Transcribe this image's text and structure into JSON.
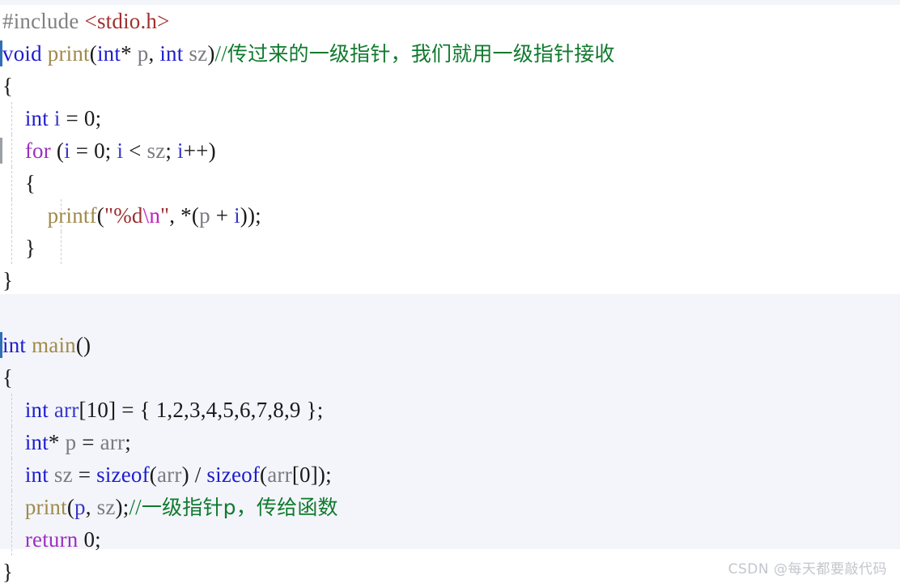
{
  "document": {
    "type": "c-source-code-snippet",
    "language": "C",
    "watermark": "CSDN @每天都要敲代码",
    "colors": {
      "background": "#ffffff",
      "block_tint": "#f4f5fa",
      "preprocessor": "#808080",
      "header_string": "#a03030",
      "keyword": "#1c1cd1",
      "control_keyword": "#9b30c0",
      "function_name": "#a08a4a",
      "variable": "#7a7a82",
      "comment": "#0f7a2e",
      "string": "#9b2f2f",
      "escape": "#c020c0",
      "change_bar": "#2f6fb5",
      "indent_guide": "#c9ccd4",
      "watermark": "#c3c6cc"
    }
  },
  "code": {
    "lines": [
      {
        "n": 1,
        "tokens": [
          {
            "t": "#include ",
            "c": "pp"
          },
          {
            "t": "<stdio.h>",
            "c": "hdr"
          }
        ]
      },
      {
        "n": 2,
        "tokens": [
          {
            "t": "void",
            "c": "kw"
          },
          {
            "t": " ",
            "c": "punct"
          },
          {
            "t": "print",
            "c": "fn"
          },
          {
            "t": "(",
            "c": "punct"
          },
          {
            "t": "int",
            "c": "kw"
          },
          {
            "t": "* ",
            "c": "punct"
          },
          {
            "t": "p",
            "c": "var"
          },
          {
            "t": ", ",
            "c": "punct"
          },
          {
            "t": "int",
            "c": "kw"
          },
          {
            "t": " ",
            "c": "punct"
          },
          {
            "t": "sz",
            "c": "var"
          },
          {
            "t": ")",
            "c": "punct"
          },
          {
            "t": "//",
            "c": "cmt"
          },
          {
            "t": "传过来的一级指针，我们就用一级指针接收",
            "c": "cmt-cn"
          }
        ]
      },
      {
        "n": 3,
        "tokens": [
          {
            "t": "{",
            "c": "punct"
          }
        ]
      },
      {
        "n": 4,
        "tokens": [
          {
            "t": "    ",
            "c": "punct"
          },
          {
            "t": "int",
            "c": "kw"
          },
          {
            "t": " ",
            "c": "punct"
          },
          {
            "t": "i",
            "c": "varb"
          },
          {
            "t": " = ",
            "c": "punct"
          },
          {
            "t": "0",
            "c": "num"
          },
          {
            "t": ";",
            "c": "punct"
          }
        ]
      },
      {
        "n": 5,
        "tokens": [
          {
            "t": "    ",
            "c": "punct"
          },
          {
            "t": "for",
            "c": "kw2"
          },
          {
            "t": " (",
            "c": "punct"
          },
          {
            "t": "i",
            "c": "varb"
          },
          {
            "t": " = ",
            "c": "punct"
          },
          {
            "t": "0",
            "c": "num"
          },
          {
            "t": "; ",
            "c": "punct"
          },
          {
            "t": "i",
            "c": "varb"
          },
          {
            "t": " < ",
            "c": "punct"
          },
          {
            "t": "sz",
            "c": "var"
          },
          {
            "t": "; ",
            "c": "punct"
          },
          {
            "t": "i",
            "c": "varb"
          },
          {
            "t": "++)",
            "c": "punct"
          }
        ]
      },
      {
        "n": 6,
        "tokens": [
          {
            "t": "    ",
            "c": "punct"
          },
          {
            "t": "{",
            "c": "punct"
          }
        ]
      },
      {
        "n": 7,
        "tokens": [
          {
            "t": "        ",
            "c": "punct"
          },
          {
            "t": "printf",
            "c": "fn"
          },
          {
            "t": "(",
            "c": "punct"
          },
          {
            "t": "\"%d",
            "c": "str"
          },
          {
            "t": "\\n",
            "c": "esc"
          },
          {
            "t": "\"",
            "c": "str"
          },
          {
            "t": ", *(",
            "c": "punct"
          },
          {
            "t": "p",
            "c": "var"
          },
          {
            "t": " + ",
            "c": "punct"
          },
          {
            "t": "i",
            "c": "varb"
          },
          {
            "t": "));",
            "c": "punct"
          }
        ]
      },
      {
        "n": 8,
        "tokens": [
          {
            "t": "    ",
            "c": "punct"
          },
          {
            "t": "}",
            "c": "punct"
          }
        ]
      },
      {
        "n": 9,
        "tokens": [
          {
            "t": "}",
            "c": "punct"
          }
        ]
      },
      {
        "n": 10,
        "tokens": [
          {
            "t": "",
            "c": "punct"
          }
        ]
      },
      {
        "n": 11,
        "tokens": [
          {
            "t": "int",
            "c": "kw"
          },
          {
            "t": " ",
            "c": "punct"
          },
          {
            "t": "main",
            "c": "fn"
          },
          {
            "t": "()",
            "c": "punct"
          }
        ]
      },
      {
        "n": 12,
        "tokens": [
          {
            "t": "{",
            "c": "punct"
          }
        ]
      },
      {
        "n": 13,
        "tokens": [
          {
            "t": "    ",
            "c": "punct"
          },
          {
            "t": "int",
            "c": "kw"
          },
          {
            "t": " ",
            "c": "punct"
          },
          {
            "t": "arr",
            "c": "varb"
          },
          {
            "t": "[",
            "c": "punct"
          },
          {
            "t": "10",
            "c": "num"
          },
          {
            "t": "] = { ",
            "c": "punct"
          },
          {
            "t": "1,2,3,4,5,6,7,8,9",
            "c": "num"
          },
          {
            "t": " };",
            "c": "punct"
          }
        ]
      },
      {
        "n": 14,
        "tokens": [
          {
            "t": "    ",
            "c": "punct"
          },
          {
            "t": "int",
            "c": "kw"
          },
          {
            "t": "* ",
            "c": "punct"
          },
          {
            "t": "p",
            "c": "var"
          },
          {
            "t": " = ",
            "c": "punct"
          },
          {
            "t": "arr",
            "c": "var"
          },
          {
            "t": ";",
            "c": "punct"
          }
        ]
      },
      {
        "n": 15,
        "tokens": [
          {
            "t": "    ",
            "c": "punct"
          },
          {
            "t": "int",
            "c": "kw"
          },
          {
            "t": " ",
            "c": "punct"
          },
          {
            "t": "sz",
            "c": "var"
          },
          {
            "t": " = ",
            "c": "punct"
          },
          {
            "t": "sizeof",
            "c": "kw"
          },
          {
            "t": "(",
            "c": "punct"
          },
          {
            "t": "arr",
            "c": "var"
          },
          {
            "t": ") / ",
            "c": "punct"
          },
          {
            "t": "sizeof",
            "c": "kw"
          },
          {
            "t": "(",
            "c": "punct"
          },
          {
            "t": "arr",
            "c": "var"
          },
          {
            "t": "[",
            "c": "punct"
          },
          {
            "t": "0",
            "c": "num"
          },
          {
            "t": "]);",
            "c": "punct"
          }
        ]
      },
      {
        "n": 16,
        "tokens": [
          {
            "t": "    ",
            "c": "punct"
          },
          {
            "t": "print",
            "c": "fn"
          },
          {
            "t": "(",
            "c": "punct"
          },
          {
            "t": "p",
            "c": "varb"
          },
          {
            "t": ", ",
            "c": "punct"
          },
          {
            "t": "sz",
            "c": "var"
          },
          {
            "t": ");",
            "c": "punct"
          },
          {
            "t": "//",
            "c": "cmt"
          },
          {
            "t": "一级指针p，传给函数",
            "c": "cmt-cn"
          }
        ]
      },
      {
        "n": 17,
        "tokens": [
          {
            "t": "    ",
            "c": "punct"
          },
          {
            "t": "return",
            "c": "kw2"
          },
          {
            "t": " ",
            "c": "punct"
          },
          {
            "t": "0",
            "c": "num"
          },
          {
            "t": ";",
            "c": "punct"
          }
        ]
      },
      {
        "n": 18,
        "tokens": [
          {
            "t": "}",
            "c": "punct"
          }
        ]
      }
    ],
    "change_bars": [
      2,
      5,
      11
    ],
    "change_bar_gray": [
      5
    ],
    "indent_guides_level1": [
      4,
      5,
      6,
      7,
      8,
      13,
      14,
      15,
      16,
      17
    ],
    "indent_guides_level2": [
      7,
      8
    ]
  }
}
